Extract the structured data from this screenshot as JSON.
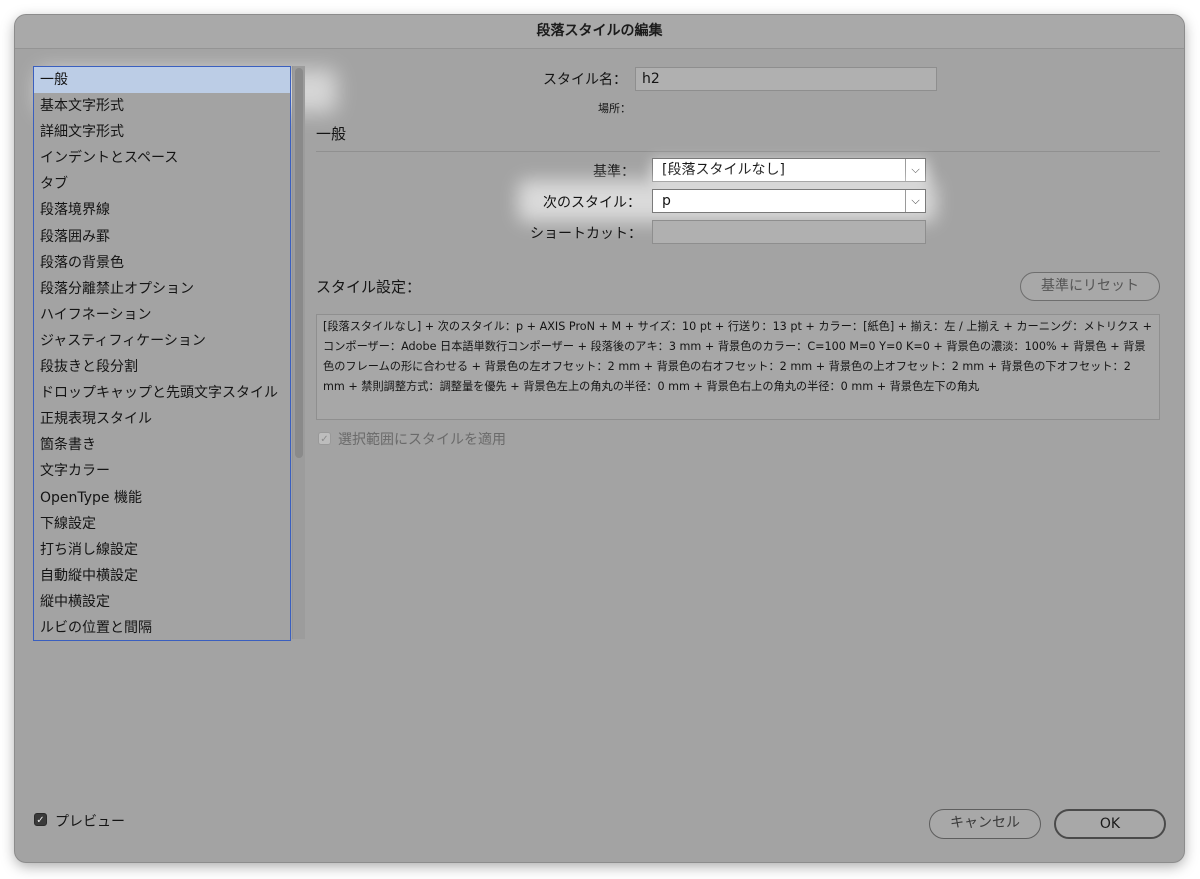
{
  "window": {
    "title": "段落スタイルの編集"
  },
  "sidebar": {
    "items": [
      {
        "label": "一般",
        "selected": true
      },
      {
        "label": "基本文字形式"
      },
      {
        "label": "詳細文字形式"
      },
      {
        "label": "インデントとスペース"
      },
      {
        "label": "タブ"
      },
      {
        "label": "段落境界線"
      },
      {
        "label": "段落囲み罫"
      },
      {
        "label": "段落の背景色"
      },
      {
        "label": "段落分離禁止オプション"
      },
      {
        "label": "ハイフネーション"
      },
      {
        "label": "ジャスティフィケーション"
      },
      {
        "label": "段抜きと段分割"
      },
      {
        "label": "ドロップキャップと先頭文字スタイル"
      },
      {
        "label": "正規表現スタイル"
      },
      {
        "label": "箇条書き"
      },
      {
        "label": "文字カラー"
      },
      {
        "label": "OpenType 機能"
      },
      {
        "label": "下線設定"
      },
      {
        "label": "打ち消し線設定"
      },
      {
        "label": "自動縦中横設定"
      },
      {
        "label": "縦中横設定"
      },
      {
        "label": "ルビの位置と間隔"
      }
    ]
  },
  "form": {
    "style_name_label": "スタイル名：",
    "style_name_value": "h2",
    "location_label": "場所：",
    "section_title": "一般",
    "based_on_label": "基準：",
    "based_on_value": "[段落スタイルなし]",
    "next_style_label": "次のスタイル：",
    "next_style_value": "p",
    "shortcut_label": "ショートカット：",
    "shortcut_value": "",
    "style_settings_label": "スタイル設定：",
    "reset_button": "基準にリセット",
    "settings_text": "[段落スタイルなし] + 次のスタイル：p + AXIS ProN + M + サイズ：10 pt + 行送り：13 pt + カラー：[紙色] + 揃え：左 / 上揃え + カーニング：メトリクス + コンポーザー：Adobe 日本語単数行コンポーザー + 段落後のアキ：3 mm + 背景色のカラー：C=100 M=0 Y=0 K=0 + 背景色の濃淡：100% + 背景色 + 背景色のフレームの形に合わせる + 背景色の左オフセット：2 mm + 背景色の右オフセット：2 mm + 背景色の上オフセット：2 mm + 背景色の下オフセット：2 mm + 禁則調整方式：調整量を優先 + 背景色左上の角丸の半径：0 mm + 背景色右上の角丸の半径：0 mm + 背景色左下の角丸",
    "apply_checkbox_label": "選択範囲にスタイルを適用",
    "apply_checked": true
  },
  "footer": {
    "preview_label": "プレビュー",
    "preview_checked": true,
    "cancel_button": "キャンセル",
    "ok_button": "OK"
  },
  "icons": {
    "dropdown_arrow": "chevron-down-icon",
    "checkbox": "checkmark-icon"
  },
  "colors": {
    "selection": "#bccde6",
    "list_border": "#3a5fbf"
  }
}
